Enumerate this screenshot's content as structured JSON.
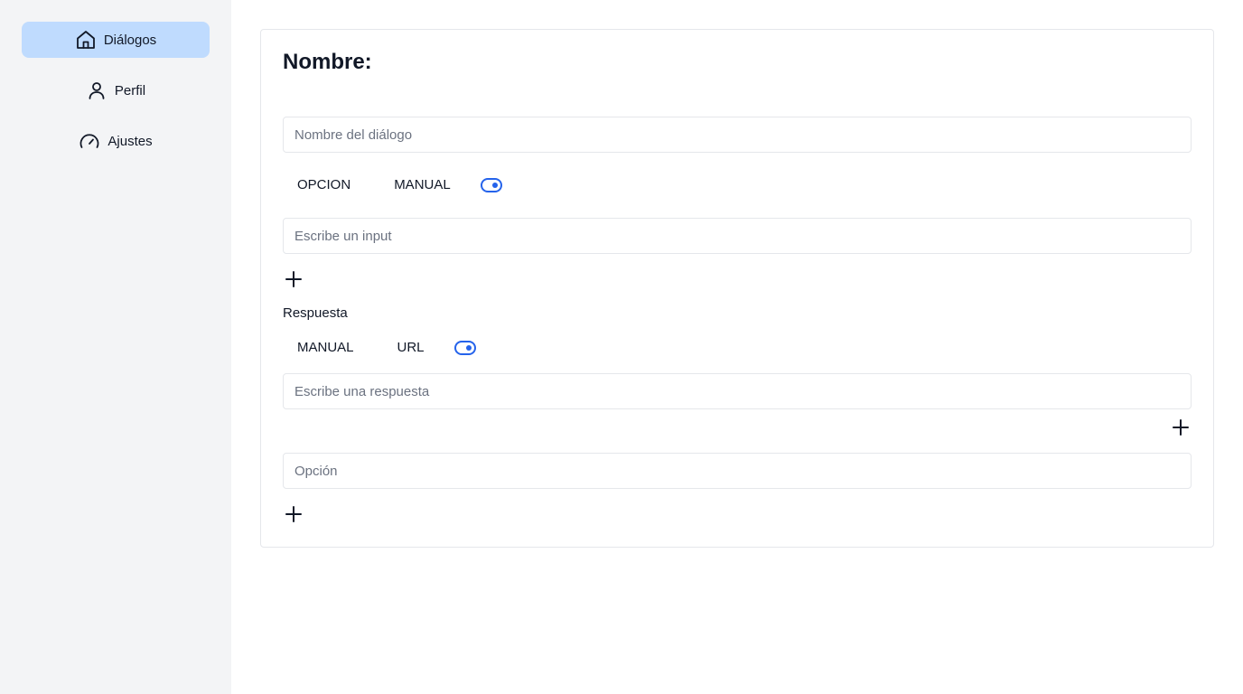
{
  "sidebar": {
    "items": [
      {
        "label": "Diálogos",
        "icon": "home-icon",
        "active": true
      },
      {
        "label": "Perfil",
        "icon": "user-icon",
        "active": false
      },
      {
        "label": "Ajustes",
        "icon": "gauge-icon",
        "active": false
      }
    ]
  },
  "form": {
    "title": "Nombre:",
    "name_field": {
      "value": "",
      "placeholder": "Nombre del diálogo"
    },
    "input_toggle": {
      "option_a": "OPCION",
      "option_b": "MANUAL"
    },
    "input_field": {
      "value": "",
      "placeholder": "Escribe un input"
    },
    "response_label": "Respuesta",
    "response_toggle": {
      "option_a": "MANUAL",
      "option_b": "URL"
    },
    "response_field": {
      "value": "",
      "placeholder": "Escribe una respuesta"
    },
    "option_field": {
      "value": "",
      "placeholder": "Opción"
    }
  },
  "colors": {
    "sidebar_bg": "#f3f4f6",
    "active_item_bg": "#bfdbfe",
    "toggle_accent": "#2563eb"
  }
}
